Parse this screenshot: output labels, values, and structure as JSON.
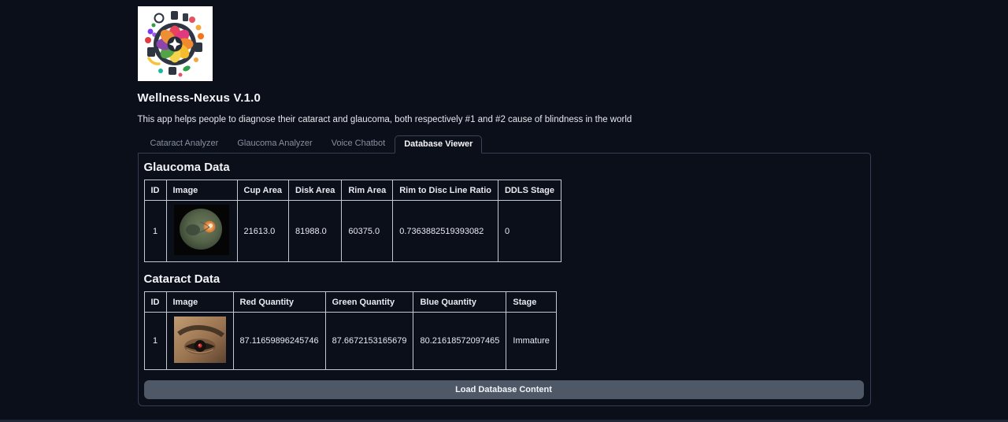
{
  "header": {
    "title": "Wellness-Nexus V.1.0",
    "description": "This app helps people to diagnose their cataract and glaucoma, both respectively #1 and #2 cause of blindness in the world",
    "logo_icon": "wellness-wheel-logo"
  },
  "tabs": [
    {
      "label": "Cataract Analyzer",
      "active": false
    },
    {
      "label": "Glaucoma Analyzer",
      "active": false
    },
    {
      "label": "Voice Chatbot",
      "active": false
    },
    {
      "label": "Database Viewer",
      "active": true
    }
  ],
  "glaucoma": {
    "heading": "Glaucoma Data",
    "columns": [
      "ID",
      "Image",
      "Cup Area",
      "Disk Area",
      "Rim Area",
      "Rim to Disc Line Ratio",
      "DDLS Stage"
    ],
    "rows": [
      {
        "id": "1",
        "image": "retinal-fundus-photo",
        "cup_area": "21613.0",
        "disk_area": "81988.0",
        "rim_area": "60375.0",
        "rim_to_disc_line_ratio": "0.7363882519393082",
        "ddls_stage": "0"
      }
    ]
  },
  "cataract": {
    "heading": "Cataract Data",
    "columns": [
      "ID",
      "Image",
      "Red Quantity",
      "Green Quantity",
      "Blue Quantity",
      "Stage"
    ],
    "rows": [
      {
        "id": "1",
        "image": "eye-closeup-photo",
        "red_quantity": "87.11659896245746",
        "green_quantity": "87.6672153165679",
        "blue_quantity": "80.21618572097465",
        "stage": "Immature"
      }
    ]
  },
  "button": {
    "label": "Load Database Content"
  },
  "colors": {
    "page_background": "#0b0f19",
    "panel_border": "#343e52",
    "table_border": "#c3c9d4",
    "button_background": "#4e5866",
    "active_tab_text": "#f5f6f8",
    "inactive_tab_text": "#868fa1"
  }
}
